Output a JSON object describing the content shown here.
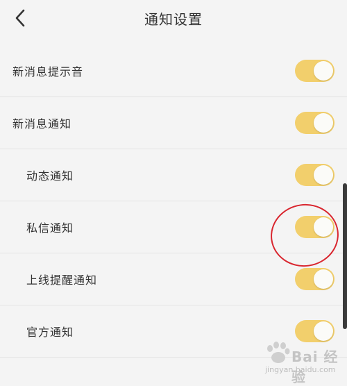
{
  "header": {
    "title": "通知设置",
    "back_icon": "chevron-left-icon"
  },
  "settings": [
    {
      "label": "新消息提示音",
      "enabled": true,
      "level": 0
    },
    {
      "label": "新消息通知",
      "enabled": true,
      "level": 0
    },
    {
      "label": "动态通知",
      "enabled": true,
      "level": 1
    },
    {
      "label": "私信通知",
      "enabled": true,
      "level": 1,
      "highlighted": true
    },
    {
      "label": "上线提醒通知",
      "enabled": true,
      "level": 1
    },
    {
      "label": "官方通知",
      "enabled": true,
      "level": 1
    }
  ],
  "watermark": {
    "brand": "Bai 经验",
    "url": "jingyan.baidu.com"
  },
  "colors": {
    "toggle_on": "#f2cf6c",
    "highlight": "#d9262f",
    "background": "#f4f4f4"
  }
}
